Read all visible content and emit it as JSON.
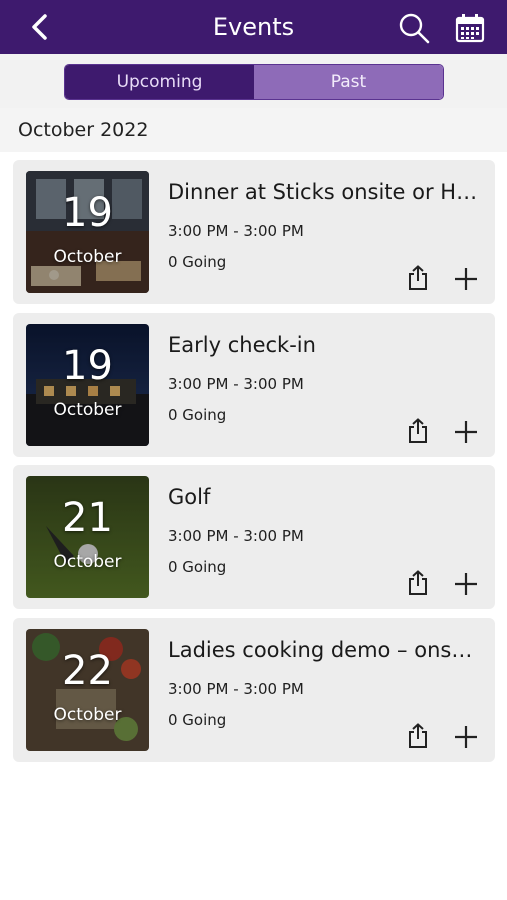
{
  "header": {
    "title": "Events",
    "color": "#3e1a6e"
  },
  "tabs": [
    {
      "label": "Upcoming",
      "active": true
    },
    {
      "label": "Past",
      "active": false
    }
  ],
  "month_heading": "October 2022",
  "events": [
    {
      "title": "Dinner at Sticks onsite or H…",
      "day": "19",
      "month": "October",
      "time": "3:00 PM - 3:00 PM",
      "going": "0 Going"
    },
    {
      "title": "Early check-in",
      "day": "19",
      "month": "October",
      "time": "3:00 PM - 3:00 PM",
      "going": "0 Going"
    },
    {
      "title": "Golf",
      "day": "21",
      "month": "October",
      "time": "3:00 PM - 3:00 PM",
      "going": "0 Going"
    },
    {
      "title": "Ladies cooking demo – onsi…",
      "day": "22",
      "month": "October",
      "time": "3:00 PM - 3:00 PM",
      "going": "0 Going"
    }
  ]
}
